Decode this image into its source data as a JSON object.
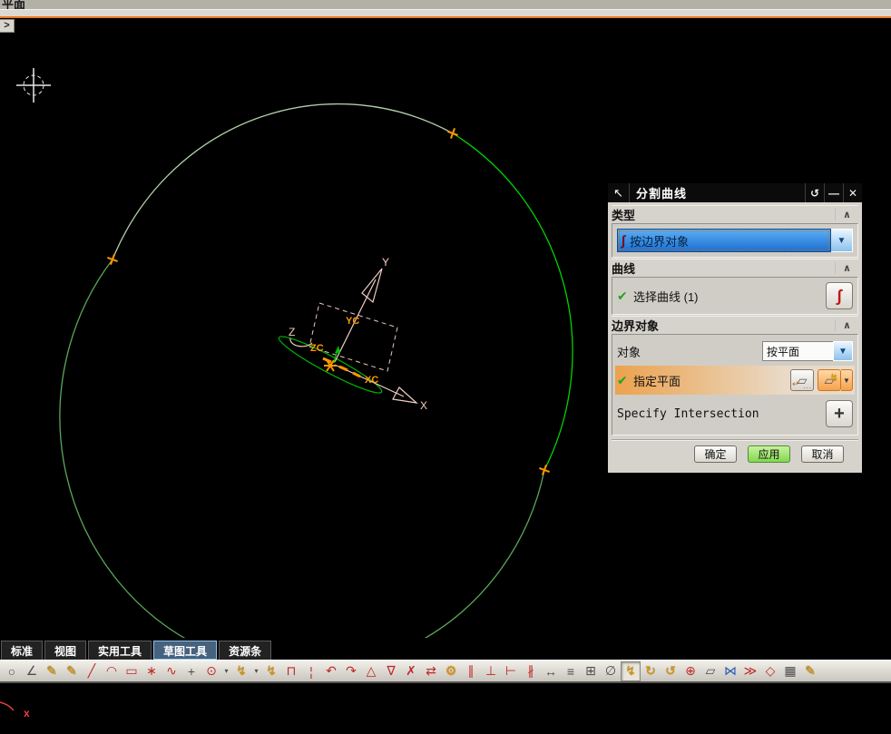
{
  "window": {
    "top_clipped_text": "平面",
    "expand_button": ">"
  },
  "viewport": {
    "axis_labels": {
      "x": "X",
      "y": "Y",
      "z": "Z",
      "xc": "XC",
      "yc": "YC",
      "zc": "ZC"
    },
    "status_marker": "x",
    "split_point_count": 3
  },
  "colors": {
    "accent_orange": "#e87820",
    "selection_blue": "#1a6fd0",
    "apply_green": "#82d850",
    "circle_green_bright": "#00d200",
    "circle_green_pale": "#aecfa6",
    "circle_green_mid": "#5aa85a",
    "axis_pink": "#f2cdc4",
    "marker_orange": "#ff9800"
  },
  "dialog": {
    "title": "分割曲线",
    "titlebar": {
      "cursor_icon": "↖",
      "reset_icon": "↺",
      "minimize_icon": "—",
      "close_icon": "✕"
    },
    "type_section": {
      "header": "类型",
      "collapse_icon": "∧",
      "combo_icon": "∫",
      "combo_value": "按边界对象",
      "combo_arrow": "▼"
    },
    "curve_section": {
      "header": "曲线",
      "collapse_icon": "∧",
      "check_icon": "✔",
      "select_label": "选择曲线 (1)",
      "curve_button_icon": "∫"
    },
    "boundary_section": {
      "header": "边界对象",
      "collapse_icon": "∧",
      "object_label": "对象",
      "object_value": "按平面",
      "object_arrow": "▼",
      "check_icon": "✔",
      "plane_label": "指定平面",
      "plane_dialog_icon": "▱",
      "plane_dialog_dots": "...",
      "plane_dialog_arrow": "↵",
      "auto_plane_icon": "▱",
      "auto_plane_bolt": "↯",
      "auto_plane_caret": "▼",
      "intersection_label": "Specify Intersection",
      "plus_icon": "+"
    },
    "footer": {
      "ok": "确定",
      "apply": "应用",
      "cancel": "取消"
    }
  },
  "tabs": {
    "items": [
      {
        "id": "standard",
        "label": "标准",
        "active": false
      },
      {
        "id": "view",
        "label": "视图",
        "active": false
      },
      {
        "id": "utility-tools",
        "label": "实用工具",
        "active": false
      },
      {
        "id": "sketch-tools",
        "label": "草图工具",
        "active": true
      },
      {
        "id": "resource-bar",
        "label": "资源条",
        "active": false
      }
    ]
  },
  "toolbar": {
    "icons": [
      {
        "name": "circle-tool-icon",
        "glyph": "○",
        "color": "gray"
      },
      {
        "name": "profile-tool-icon",
        "glyph": "∠",
        "color": "gray"
      },
      {
        "name": "studio-spline-icon",
        "glyph": "✎",
        "color": "gold"
      },
      {
        "name": "studio-spline-constrained-icon",
        "glyph": "✎",
        "color": "gold"
      },
      {
        "name": "line-tool-icon",
        "glyph": "╱",
        "color": "red"
      },
      {
        "name": "arc-tool-icon",
        "glyph": "◠",
        "color": "red"
      },
      {
        "name": "rectangle-tool-icon",
        "glyph": "▭",
        "color": "red"
      },
      {
        "name": "polygon-point-icon",
        "glyph": "∗",
        "color": "red"
      },
      {
        "name": "spline-tool-icon",
        "glyph": "∿",
        "color": "red"
      },
      {
        "name": "point-tool-icon",
        "glyph": "+",
        "color": "gray"
      },
      {
        "name": "ellipse-tool-icon",
        "glyph": "⊙",
        "color": "red"
      },
      {
        "name": "ellipse-dropdown-icon",
        "glyph": "▾",
        "color": "gray",
        "narrow": true
      },
      {
        "name": "quick-trim-icon",
        "glyph": "↯",
        "color": "gold"
      },
      {
        "name": "quick-trim-dropdown-icon",
        "glyph": "▾",
        "color": "gray",
        "narrow": true
      },
      {
        "name": "quick-extend-icon",
        "glyph": "↯",
        "color": "gold"
      },
      {
        "name": "make-corner-icon",
        "glyph": "⊓",
        "color": "red"
      },
      {
        "name": "show-vertices-icon",
        "glyph": "¦",
        "color": "red"
      },
      {
        "name": "fillet-icon",
        "glyph": "↶",
        "color": "red"
      },
      {
        "name": "chamfer-icon",
        "glyph": "↷",
        "color": "red"
      },
      {
        "name": "geometric-constraints-icon",
        "glyph": "△",
        "color": "red"
      },
      {
        "name": "auto-constrain-icon",
        "glyph": "∇",
        "color": "red"
      },
      {
        "name": "show-remove-constraints-icon",
        "glyph": "✗",
        "color": "red"
      },
      {
        "name": "convert-reference-icon",
        "glyph": "⇄",
        "color": "red"
      },
      {
        "name": "alternate-solution-icon",
        "glyph": "⚙",
        "color": "gold"
      },
      {
        "name": "inferred-constraints-icon",
        "glyph": "∥",
        "color": "red"
      },
      {
        "name": "create-inferred-constraints-icon",
        "glyph": "⊥",
        "color": "red"
      },
      {
        "name": "continuous-auto-dimension-icon",
        "glyph": "⊢",
        "color": "red"
      },
      {
        "name": "auto-dimension-icon",
        "glyph": "∦",
        "color": "red"
      },
      {
        "name": "dimensions-icon",
        "glyph": "↔",
        "color": "gray"
      },
      {
        "name": "show-all-constraints-icon",
        "glyph": "≡",
        "color": "gray"
      },
      {
        "name": "sketch-group-icon",
        "glyph": "⊞",
        "color": "gray"
      },
      {
        "name": "show-degrees-freedom-icon",
        "glyph": "∅",
        "color": "gray"
      },
      {
        "name": "divide-curve-icon",
        "glyph": "↯",
        "color": "gold",
        "active": true
      },
      {
        "name": "edit-defining-section-icon",
        "glyph": "↻",
        "color": "gold"
      },
      {
        "name": "update-model-icon",
        "glyph": "↺",
        "color": "gold"
      },
      {
        "name": "add-existing-curve-icon",
        "glyph": "⊕",
        "color": "red"
      },
      {
        "name": "project-curve-icon",
        "glyph": "▱",
        "color": "gray"
      },
      {
        "name": "intersect-curve-icon",
        "glyph": "⋈",
        "color": "blue"
      },
      {
        "name": "derived-line-icon",
        "glyph": "≫",
        "color": "red"
      },
      {
        "name": "offset-curve-icon",
        "glyph": "◇",
        "color": "red"
      },
      {
        "name": "pattern-curve-icon",
        "glyph": "▦",
        "color": "gray"
      },
      {
        "name": "edit-curve-icon",
        "glyph": "✎",
        "color": "gold"
      }
    ]
  }
}
